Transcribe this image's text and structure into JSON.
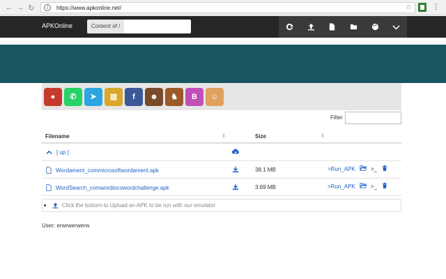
{
  "browser": {
    "url": "https://www.apkonline.net/"
  },
  "topbar": {
    "brand": "APKOnline",
    "path_label": "Content of /",
    "path_value": "",
    "icons": [
      "refresh-icon",
      "upload-icon",
      "file-icon",
      "folder-icon",
      "palette-icon",
      "chevron-down-icon"
    ]
  },
  "apps": [
    {
      "name": "angry-birds",
      "color": "#c33b2c",
      "glyph": "●"
    },
    {
      "name": "whatsapp",
      "color": "#25d366",
      "glyph": "✆"
    },
    {
      "name": "telegram",
      "color": "#2ca5e0",
      "glyph": "➤"
    },
    {
      "name": "bars-app",
      "color": "#d9a82b",
      "glyph": "▥"
    },
    {
      "name": "facebook",
      "color": "#3b5998",
      "glyph": "f"
    },
    {
      "name": "game-character",
      "color": "#7a4b2a",
      "glyph": "☻"
    },
    {
      "name": "chess-board",
      "color": "#9b5a28",
      "glyph": "♞"
    },
    {
      "name": "bingo",
      "color": "#c04fb8",
      "glyph": "B"
    },
    {
      "name": "sunglasses-character",
      "color": "#e0a060",
      "glyph": "☺"
    }
  ],
  "filter": {
    "label": "Filter",
    "value": ""
  },
  "table": {
    "headers": {
      "filename": "Filename",
      "size": "Size"
    },
    "up_label": "[ up ]",
    "rows": [
      {
        "name": "Wordament_commicrosoftwordament.apk",
        "size": "38.1 MB"
      },
      {
        "name": "WordSearch_comwordiocowordchallenge.apk",
        "size": "3.69 MB"
      }
    ],
    "run_label": ">Run_APK",
    "terminal_label": ">_"
  },
  "upload": {
    "text": "Click the bottom to Upload an APK to be run with our emulator"
  },
  "user": {
    "text": "User: erwrwerwerw"
  }
}
